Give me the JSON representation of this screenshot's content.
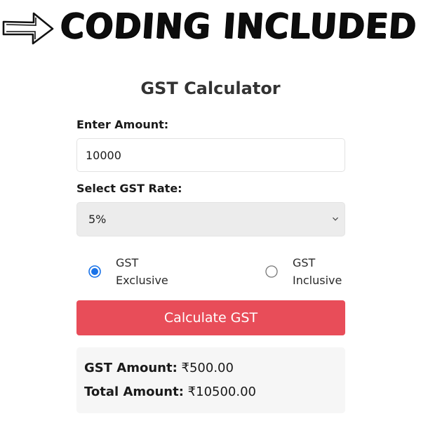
{
  "banner": {
    "icon": "arrow-right-icon",
    "title": "CODING INCLUDED"
  },
  "app": {
    "title": "GST Calculator"
  },
  "form": {
    "amount_label": "Enter Amount:",
    "amount_value": "10000",
    "rate_label": "Select GST Rate:",
    "rate_selected": "5%",
    "options": [
      {
        "line1": "GST",
        "line2": "Exclusive",
        "selected": true
      },
      {
        "line1": "GST",
        "line2": "Inclusive",
        "selected": false
      }
    ],
    "button_label": "Calculate GST"
  },
  "result": {
    "gst_label": "GST Amount:",
    "gst_value": "₹500.00",
    "total_label": "Total Amount:",
    "total_value": "₹10500.00"
  },
  "colors": {
    "accent": "#e84d59",
    "radio_selected": "#1a73e8",
    "select_bg": "#ececec",
    "result_bg": "#f6f6f6"
  }
}
